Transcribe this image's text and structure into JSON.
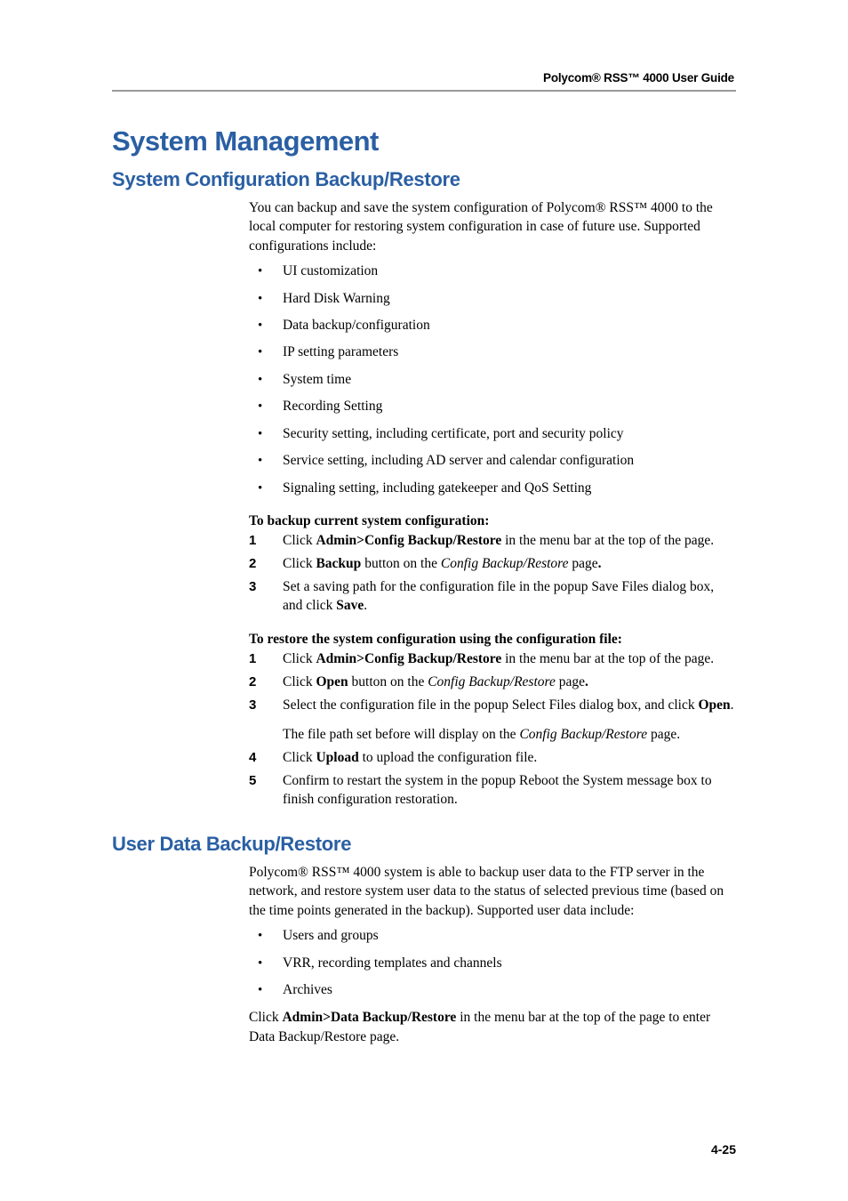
{
  "header": {
    "title": "Polycom® RSS™ 4000 User Guide"
  },
  "h1": "System Management",
  "section1": {
    "h2": "System Configuration Backup/Restore",
    "intro": "You can backup and save the system configuration of Polycom® RSS™ 4000 to the local computer for restoring system configuration in case of future use. Supported configurations include:",
    "bullets": [
      "UI customization",
      "Hard Disk Warning",
      "Data backup/configuration",
      "IP setting parameters",
      "System time",
      "Recording Setting",
      "Security setting, including certificate, port and security policy",
      "Service setting, including AD server and calendar configuration",
      "Signaling setting, including gatekeeper and QoS Setting"
    ],
    "proc1_heading": "To backup current system configuration:",
    "proc2_heading": "To restore the system configuration using the configuration file:"
  },
  "section2": {
    "h2": "User Data Backup/Restore",
    "intro": "Polycom® RSS™ 4000 system is able to backup user data to the FTP server in the network, and restore system user data to the status of selected previous time (based on the time points generated in the backup). Supported user data include:",
    "bullets": [
      "Users and groups",
      "VRR, recording templates and channels",
      "Archives"
    ]
  },
  "page_num": "4-25"
}
